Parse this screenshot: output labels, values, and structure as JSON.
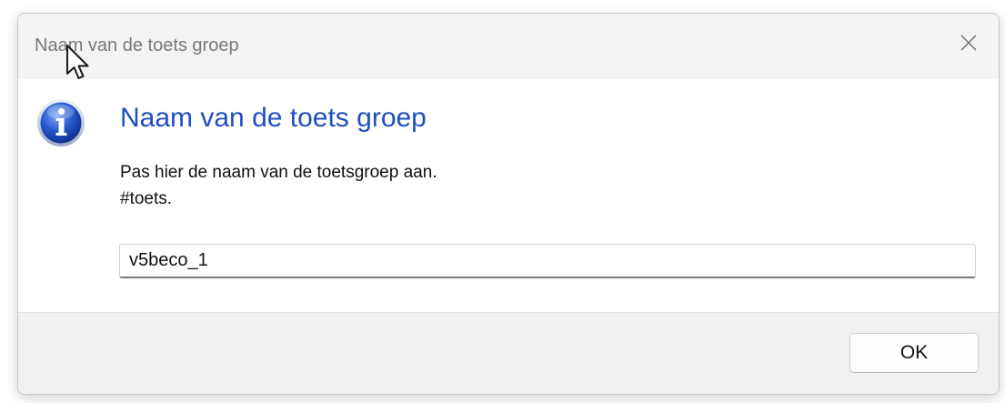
{
  "window": {
    "title": "Naam van de toets groep",
    "close_icon": "close-icon"
  },
  "content": {
    "icon": "info-icon",
    "heading": "Naam van de toets groep",
    "message_lines": [
      "Pas hier de naam van de toetsgroep aan.",
      "#toets."
    ],
    "input_value": "v5beco_1"
  },
  "footer": {
    "ok_label": "OK"
  },
  "colors": {
    "heading": "#1f4fbf",
    "titlebar": "#f3f3f3",
    "footer": "#f0f0f0",
    "info_blue": "#1c4fc4"
  },
  "pointer": {
    "icon": "mouse-cursor-icon"
  }
}
